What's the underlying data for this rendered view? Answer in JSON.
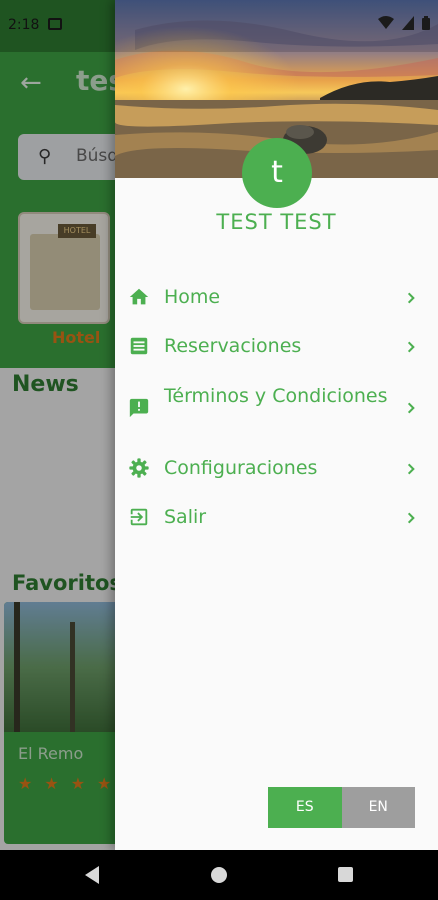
{
  "status_bar": {
    "time": "2:18"
  },
  "background_screen": {
    "title": "tes",
    "search_placeholder": "Búsq",
    "category_label": "Hotel",
    "hotel_sign_text": "HOTEL",
    "news_heading": "News",
    "favorites_heading": "Favoritos",
    "favorite_name": "El Remo",
    "favorite_stars": "★★★★"
  },
  "drawer": {
    "avatar_letter": "t",
    "user_name": "TEST TEST",
    "menu": [
      {
        "label": "Home",
        "icon": "home-icon"
      },
      {
        "label": "Reservaciones",
        "icon": "list-icon"
      },
      {
        "label": "Términos y Condiciones",
        "icon": "feedback-icon"
      },
      {
        "label": "Configuraciones",
        "icon": "gear-icon"
      },
      {
        "label": "Salir",
        "icon": "exit-icon"
      }
    ],
    "language": {
      "es": "ES",
      "en": "EN",
      "selected": "ES"
    }
  },
  "colors": {
    "accent_green": "#4caf50",
    "dark_green": "#2e7d32",
    "inactive_grey": "#9e9e9e",
    "star_orange": "#e07b1b"
  }
}
